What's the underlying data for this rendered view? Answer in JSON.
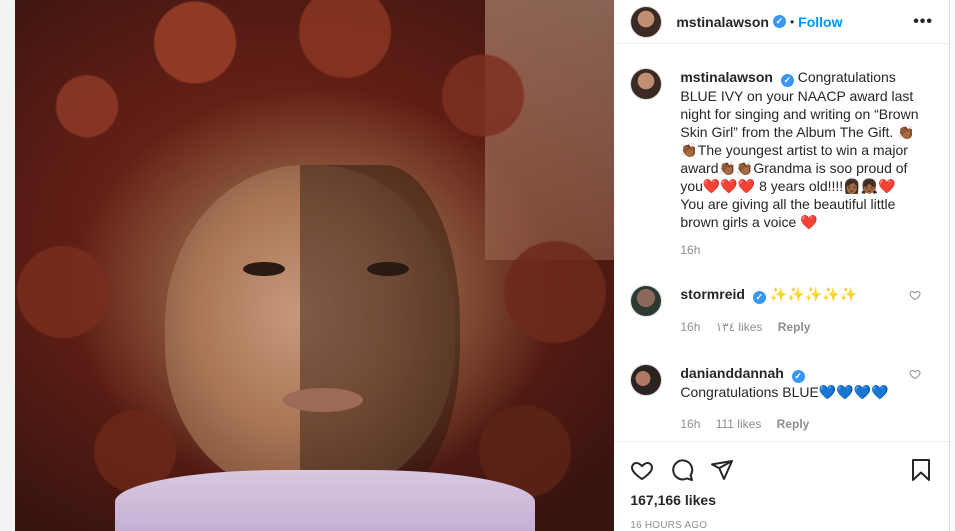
{
  "post": {
    "username": "mstinalawson",
    "verified_glyph": "✓",
    "separator": "•",
    "follow_label": "Follow",
    "more_label": "•••",
    "caption": "Congratulations BLUE IVY on your NAACP award last night for singing and writing on “Brown Skin Girl” from the Album The Gift. 👏🏾👏🏾The youngest artist to win a major award👏🏾👏🏾Grandma is soo proud of you❤️❤️❤️ 8 years old!!!!👩🏾‍👧🏾❤️ You are giving all the beautiful little brown girls a voice ❤️",
    "caption_time": "16h",
    "likes": "167,166 likes",
    "posted_ago": "16 HOURS AGO"
  },
  "comments": [
    {
      "username": "stormreid",
      "text": "✨✨✨✨✨",
      "time": "16h",
      "likes": "١٣٤ likes",
      "reply_label": "Reply"
    },
    {
      "username": "danianddannah",
      "text": "Congratulations BLUE💙💙💙💙",
      "time": "16h",
      "likes": "111 likes",
      "reply_label": "Reply"
    }
  ],
  "icons": {
    "like": "heart-icon",
    "comment": "comment-icon",
    "share": "share-icon",
    "save": "bookmark-icon"
  },
  "colors": {
    "accent": "#0095f6",
    "verified": "#3897f0",
    "muted": "#8e8e8e"
  }
}
